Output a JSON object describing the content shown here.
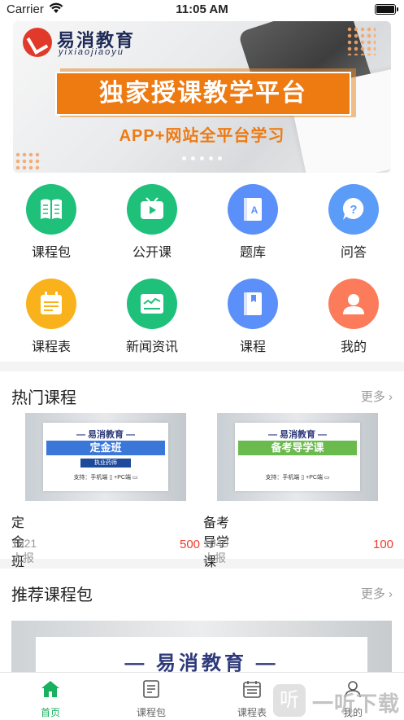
{
  "status_bar": {
    "carrier": "Carrier",
    "time": "11:05 AM"
  },
  "banner": {
    "logo_text": "易消教育",
    "logo_sub": "yixiaojiaoyu",
    "headline": "独家授课教学平台",
    "subline": "APP+网站全平台学习",
    "page_count": 5
  },
  "grid": [
    {
      "label": "课程包",
      "color": "#1fc07a",
      "icon": "book-icon"
    },
    {
      "label": "公开课",
      "color": "#1fc07a",
      "icon": "tv-icon"
    },
    {
      "label": "题库",
      "color": "#5b8ff9",
      "icon": "question-bank-icon"
    },
    {
      "label": "问答",
      "color": "#5b9cf9",
      "icon": "qa-icon"
    },
    {
      "label": "课程表",
      "color": "#f9b21b",
      "icon": "calendar-icon"
    },
    {
      "label": "新闻资讯",
      "color": "#1fc07a",
      "icon": "news-icon"
    },
    {
      "label": "课程",
      "color": "#5b8ff9",
      "icon": "course-book-icon"
    },
    {
      "label": "我的",
      "color": "#fb7b5b",
      "icon": "profile-icon"
    }
  ],
  "hot": {
    "title": "热门课程",
    "more": "更多 ›",
    "courses": [
      {
        "brand": "— 易消教育 —",
        "image_title": "定金班",
        "image_tag": "执业药师",
        "image_support": "支持：手机端 ▯ +PC端 ▭",
        "name": "定金班",
        "count": "1021人报名",
        "price": "500",
        "banner_color": "#3b77d8"
      },
      {
        "brand": "— 易消教育 —",
        "image_title": "备考导学课",
        "image_tag": "",
        "image_support": "支持：手机端 ▯ +PC端 ▭",
        "name": "备考导学课（西药）",
        "count": "1040人报名",
        "price": "100",
        "banner_color": "#6aba4e"
      }
    ]
  },
  "recommend": {
    "title": "推荐课程包",
    "more": "更多 ›",
    "image_brand": "— 易消教育 —"
  },
  "tabbar": [
    {
      "label": "首页",
      "icon": "home-icon",
      "active": true
    },
    {
      "label": "课程包",
      "icon": "document-icon",
      "active": false
    },
    {
      "label": "课程表",
      "icon": "calendar-icon",
      "active": false
    },
    {
      "label": "我的",
      "icon": "user-icon",
      "active": false
    }
  ],
  "watermark": {
    "glyph": "听",
    "text": "一听下载"
  }
}
